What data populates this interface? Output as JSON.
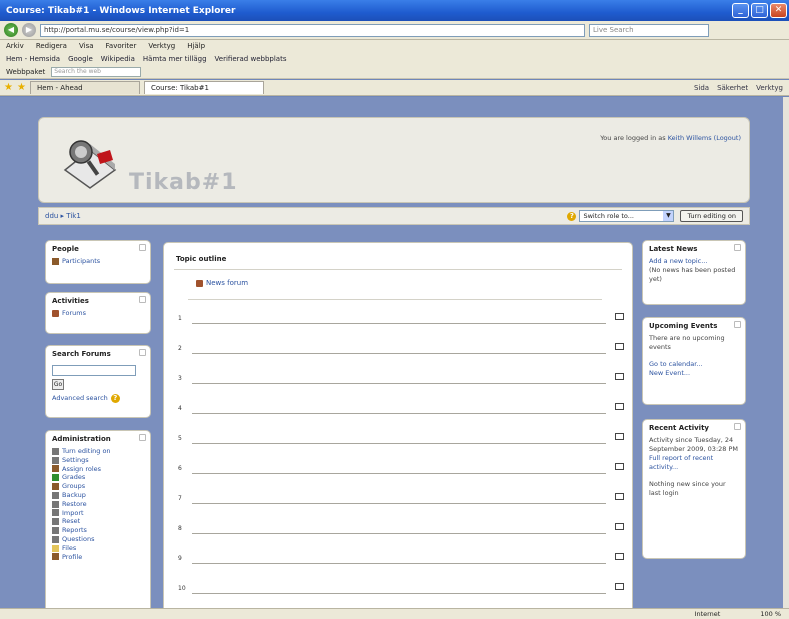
{
  "window": {
    "title": "Course: Tikab#1 - Windows Internet Explorer",
    "address": "http://portal.mu.se/course/view.php?id=1",
    "search_placeholder": "Live Search"
  },
  "menu": [
    "Arkiv",
    "Redigera",
    "Visa",
    "Favoriter",
    "Verktyg",
    "Hjälp"
  ],
  "links": [
    "Hem - Hemsida",
    "Google",
    "Wikipedia",
    "Hämta mer tillägg",
    "Verifierad webbplats"
  ],
  "toolbar2": {
    "label": "Webbpaket",
    "search": "Search the web"
  },
  "tabs": [
    {
      "label": "Hem - Ahead",
      "icon": "ie-icon"
    },
    {
      "label": "Course: Tikab#1",
      "icon": "page-icon"
    }
  ],
  "tab_tools": [
    "Sida",
    "Säkerhet",
    "Verktyg"
  ],
  "header": {
    "site_name": "Tikab#1",
    "login_prefix": "You are logged in as",
    "login_user": "Keith Willems (Logout)"
  },
  "navbar": {
    "crumb": "ddu ▸ Tik1",
    "switch_role": "Switch role to...",
    "edit_button": "Turn editing on"
  },
  "blocks": {
    "people": {
      "title": "People",
      "items": [
        "Participants"
      ]
    },
    "activities": {
      "title": "Activities",
      "items": [
        "Forums"
      ]
    },
    "search": {
      "title": "Search Forums",
      "go": "Go",
      "advanced": "Advanced search"
    },
    "admin": {
      "title": "Administration",
      "items": [
        "Turn editing on",
        "Settings",
        "Assign roles",
        "Grades",
        "Groups",
        "Backup",
        "Restore",
        "Import",
        "Reset",
        "Reports",
        "Questions",
        "Files",
        "Profile"
      ]
    },
    "news": {
      "title": "Latest News",
      "add": "Add a new topic...",
      "empty": "(No news has been posted yet)"
    },
    "events": {
      "title": "Upcoming Events",
      "empty": "There are no upcoming events",
      "calendar": "Go to calendar...",
      "new_event": "New Event..."
    },
    "activity": {
      "title": "Recent Activity",
      "since": "Activity since Tuesday, 24 September 2009, 03:28 PM",
      "full_report": "Full report of recent activity...",
      "nothing": "Nothing new since your last login"
    }
  },
  "main": {
    "outline_title": "Topic outline",
    "news_forum": "News forum",
    "topics": [
      "1",
      "2",
      "3",
      "4",
      "5",
      "6",
      "7",
      "8",
      "9",
      "10"
    ]
  },
  "status": {
    "zone": "Internet",
    "zoom": "100 %"
  }
}
